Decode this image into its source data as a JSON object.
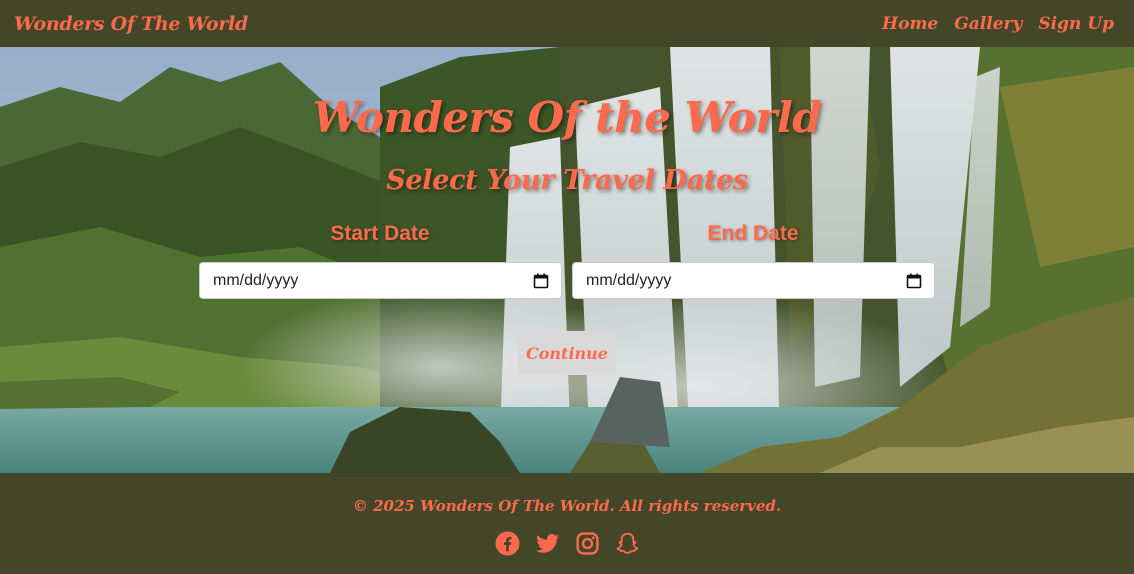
{
  "navbar": {
    "brand": "Wonders Of The World",
    "links": [
      "Home",
      "Gallery",
      "Sign Up"
    ]
  },
  "hero": {
    "title": "Wonders Of the World",
    "subtitle": "Select Your Travel Dates",
    "start_label": "Start Date",
    "end_label": "End Date",
    "start_placeholder": "mm/dd/yyyy",
    "end_placeholder": "mm/dd/yyyy",
    "continue_label": "Continue"
  },
  "footer": {
    "copyright": "© 2025 Wonders Of The World. All rights reserved.",
    "socials": [
      "facebook-icon",
      "twitter-icon",
      "instagram-icon",
      "snapchat-icon"
    ]
  },
  "colors": {
    "accent": "#ff6a4d",
    "bar_bg": "#444628",
    "button_bg": "#d9d9d9"
  }
}
